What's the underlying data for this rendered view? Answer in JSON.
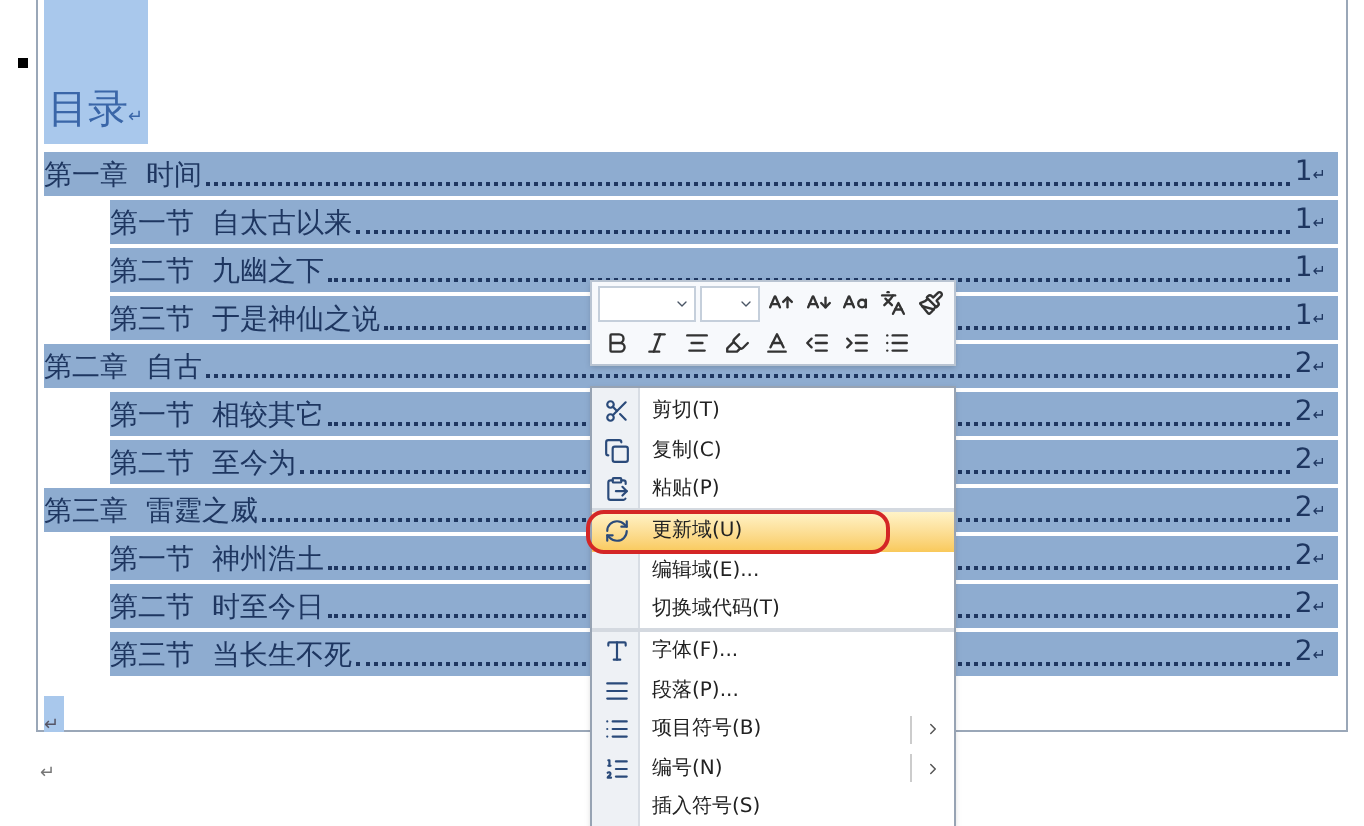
{
  "document": {
    "title": "目录",
    "title_end": "↵",
    "end_mark": "↵",
    "after_mark": "↵",
    "toc": {
      "selected": true,
      "entries": [
        {
          "kind": "chapter",
          "text": "第一章  时间",
          "page": "1",
          "end": "↵"
        },
        {
          "kind": "section",
          "text": "第一节  自太古以来",
          "page": "1",
          "end": "↵"
        },
        {
          "kind": "section",
          "text": "第二节  九幽之下",
          "page": "1",
          "end": "↵"
        },
        {
          "kind": "section",
          "text": "第三节  于是神仙之说",
          "page": "1",
          "end": "↵"
        },
        {
          "kind": "chapter",
          "text": "第二章  自古",
          "page": "2",
          "end": "↵"
        },
        {
          "kind": "section",
          "text": "第一节  相较其它",
          "page": "2",
          "end": "↵"
        },
        {
          "kind": "section",
          "text": "第二节  至今为",
          "page": "2",
          "end": "↵"
        },
        {
          "kind": "chapter",
          "text": "第三章  雷霆之威",
          "page": "2",
          "end": "↵"
        },
        {
          "kind": "section",
          "text": "第一节  神州浩土",
          "page": "2",
          "end": "↵"
        },
        {
          "kind": "section",
          "text": "第二节  时至今日",
          "page": "2",
          "end": "↵"
        },
        {
          "kind": "section",
          "text": "第三节  当长生不死",
          "page": "2",
          "end": "↵"
        }
      ]
    }
  },
  "context_menu": {
    "items": [
      {
        "label": "剪切(T)",
        "selected": false,
        "circled": false,
        "submenu": false,
        "separator_after": false
      },
      {
        "label": "复制(C)",
        "selected": false,
        "circled": false,
        "submenu": false,
        "separator_after": false
      },
      {
        "label": "粘贴(P)",
        "selected": false,
        "circled": false,
        "submenu": false,
        "separator_after": true
      },
      {
        "label": "更新域(U)",
        "selected": true,
        "circled": true,
        "submenu": false,
        "separator_after": false
      },
      {
        "label": "编辑域(E)...",
        "selected": false,
        "circled": false,
        "submenu": false,
        "separator_after": false
      },
      {
        "label": "切换域代码(T)",
        "selected": false,
        "circled": false,
        "submenu": false,
        "separator_after": true
      },
      {
        "label": "字体(F)...",
        "selected": false,
        "circled": false,
        "submenu": false,
        "separator_after": false
      },
      {
        "label": "段落(P)...",
        "selected": false,
        "circled": false,
        "submenu": false,
        "separator_after": false
      },
      {
        "label": "项目符号(B)",
        "selected": false,
        "circled": false,
        "submenu": true,
        "separator_after": false
      },
      {
        "label": "编号(N)",
        "selected": false,
        "circled": false,
        "submenu": true,
        "separator_after": false
      },
      {
        "label": "插入符号(S)",
        "selected": false,
        "circled": false,
        "submenu": false,
        "separator_after": false
      }
    ]
  }
}
